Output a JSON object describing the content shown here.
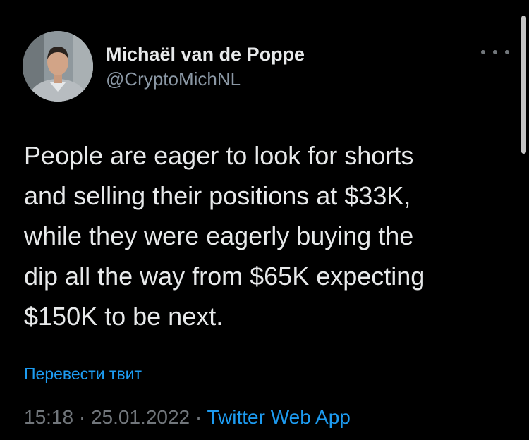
{
  "author": {
    "display_name": "Michaël van de Poppe",
    "handle": "@CryptoMichNL"
  },
  "tweet": {
    "text": "People are eager to look for shorts\nand selling their positions at $33K,\nwhile they were eagerly buying the\ndip all the way from $65K expecting\n$150K to be next.",
    "translate_label": "Перевести твит",
    "time": "15:18",
    "separator": " · ",
    "date": "25.01.2022",
    "source": "Twitter Web App"
  },
  "icons": {
    "more": "more-horizontal-icon"
  },
  "colors": {
    "background": "#000000",
    "text_primary": "#e7e9ea",
    "text_secondary": "#71767b",
    "accent": "#1d9bf0"
  }
}
